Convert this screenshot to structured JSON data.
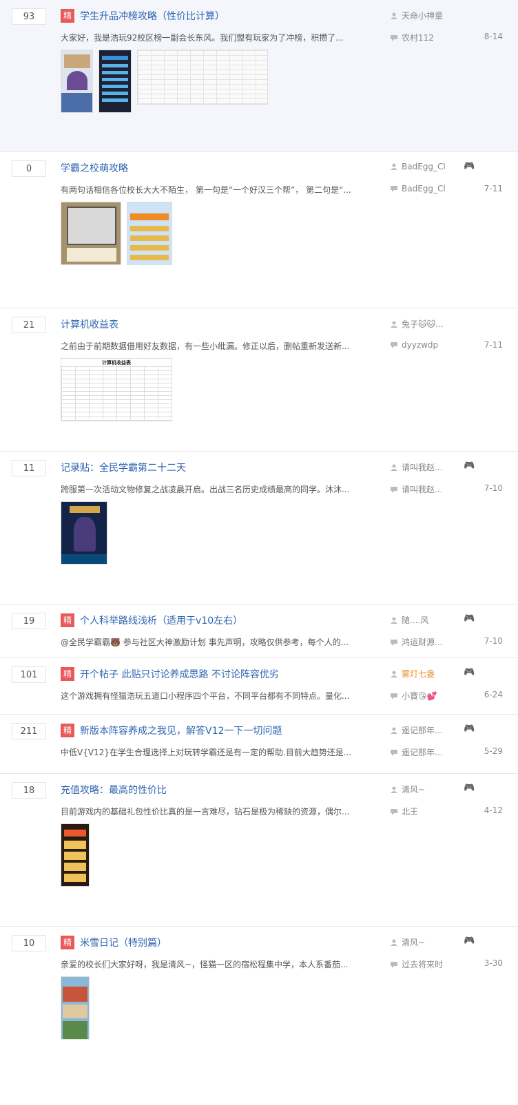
{
  "threads": [
    {
      "replies": "93",
      "jing": "精",
      "title": "学生升品冲榜攻略（性价比计算）",
      "abstract": "大家好，我是浩玩92校区榜一副会长东风。我们盟有玩家为了冲榜，积攒了...",
      "author": "天命小神童",
      "last_reply": "农村112",
      "date": "8-14"
    },
    {
      "replies": "0",
      "title": "学霸之校萌攻略",
      "abstract": "有两句话相信各位校长大大不陌生， 第一句是“一个好汉三个帮”， 第二句是“...",
      "author": "BadEgg_Cl",
      "last_reply": "BadEgg_Cl",
      "date": "7-11"
    },
    {
      "replies": "21",
      "title": "计算机收益表",
      "abstract": "之前由于前期数据借用好友数据，有一些小纰漏。修正以后，删帖重新发送新...",
      "author": "兔子🐱🐱…",
      "last_reply": "dyyzwdp",
      "date": "7-11",
      "table_title": "计算机收益表"
    },
    {
      "replies": "11",
      "title": "记录贴：全民学霸第二十二天",
      "abstract": "跨服第一次活动文物修复之战凌晨开启。出战三名历史成绩最高的同学。沐沐...",
      "author": "请叫我赵...",
      "last_reply": "请叫我赵...",
      "date": "7-10"
    },
    {
      "replies": "19",
      "jing": "精",
      "title": "个人科举路线浅析（适用于v10左右）",
      "abstract": "@全民学霸霸🐻 参与社区大神激励计划 事先声明，攻略仅供参考，每个人的...",
      "author": "随....风",
      "last_reply": "鸿运财源...",
      "date": "7-10"
    },
    {
      "replies": "101",
      "jing": "精",
      "title": "开个帖子 此贴只讨论养成思路 不讨论阵容优劣",
      "abstract": "这个游戏拥有怪猫浩玩五道口小程序四个平台，不同平台都有不同特点。量化...",
      "author": "雾灯七盏",
      "last_reply": "小寶😘💕",
      "date": "6-24"
    },
    {
      "replies": "211",
      "jing": "精",
      "title": "新版本阵容养成之我见，解答V12一下一切问题",
      "abstract": "中低V{V12}在学生合理选择上对玩转学霸还是有一定的帮助.目前大趋势还是...",
      "author": "遥记那年...",
      "last_reply": "遥记那年...",
      "date": "5-29"
    },
    {
      "replies": "18",
      "title": "充值攻略：最高的性价比",
      "abstract": "目前游戏内的基础礼包性价比真的是一言难尽，钻石是极为稀缺的资源，偶尔...",
      "author": "清风~",
      "last_reply": "北王",
      "date": "4-12"
    },
    {
      "replies": "10",
      "jing": "精",
      "title": "米雪日记（特别篇）",
      "abstract": "亲爱的校长们大家好呀，我是清风~，怪猫一区的宿松程集中学，本人系番茄...",
      "author": "清风~",
      "last_reply": "过去将来时",
      "date": "3-30"
    }
  ],
  "icons": {
    "user": "user-icon",
    "reply": "comment-icon",
    "game": "gamepad-icon"
  },
  "colors": {
    "title": "#2d64b3",
    "jing": "#e85a5a",
    "vip": "#f08a24",
    "highlight": "#f4f6fb"
  }
}
